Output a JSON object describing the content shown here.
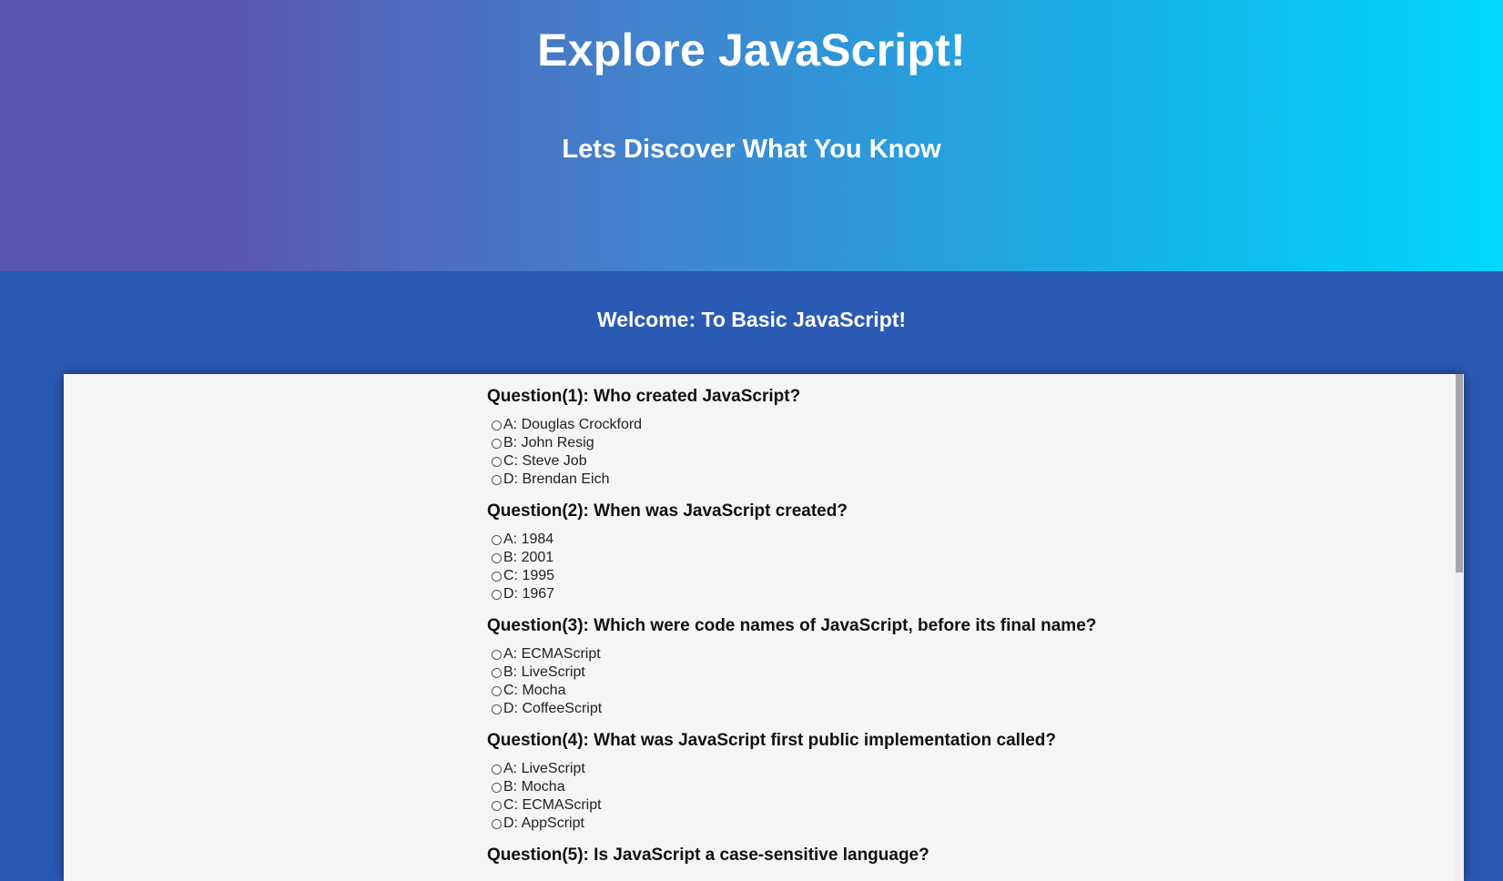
{
  "header": {
    "title": "Explore JavaScript!",
    "subtitle": "Lets Discover What You Know"
  },
  "welcome": "Welcome: To Basic JavaScript!",
  "colors": {
    "gradient_start": "#5a57b0",
    "gradient_end": "#00d8ff",
    "page_background": "#2b5ab5",
    "panel_background": "#f5f5f5"
  },
  "questions": [
    {
      "title": "Question(1): Who created JavaScript?",
      "options": [
        "A: Douglas Crockford",
        "B: John Resig",
        "C: Steve Job",
        "D: Brendan Eich"
      ]
    },
    {
      "title": "Question(2): When was JavaScript created?",
      "options": [
        "A: 1984",
        "B: 2001",
        "C: 1995",
        "D: 1967"
      ]
    },
    {
      "title": "Question(3): Which were code names of JavaScript, before its final name?",
      "options": [
        "A: ECMAScript",
        "B: LiveScript",
        "C: Mocha",
        "D: CoffeeScript"
      ]
    },
    {
      "title": "Question(4): What was JavaScript first public implementation called?",
      "options": [
        "A: LiveScript",
        "B: Mocha",
        "C: ECMAScript",
        "D: AppScript"
      ]
    },
    {
      "title": "Question(5): Is JavaScript a case-sensitive language?",
      "options": []
    }
  ]
}
